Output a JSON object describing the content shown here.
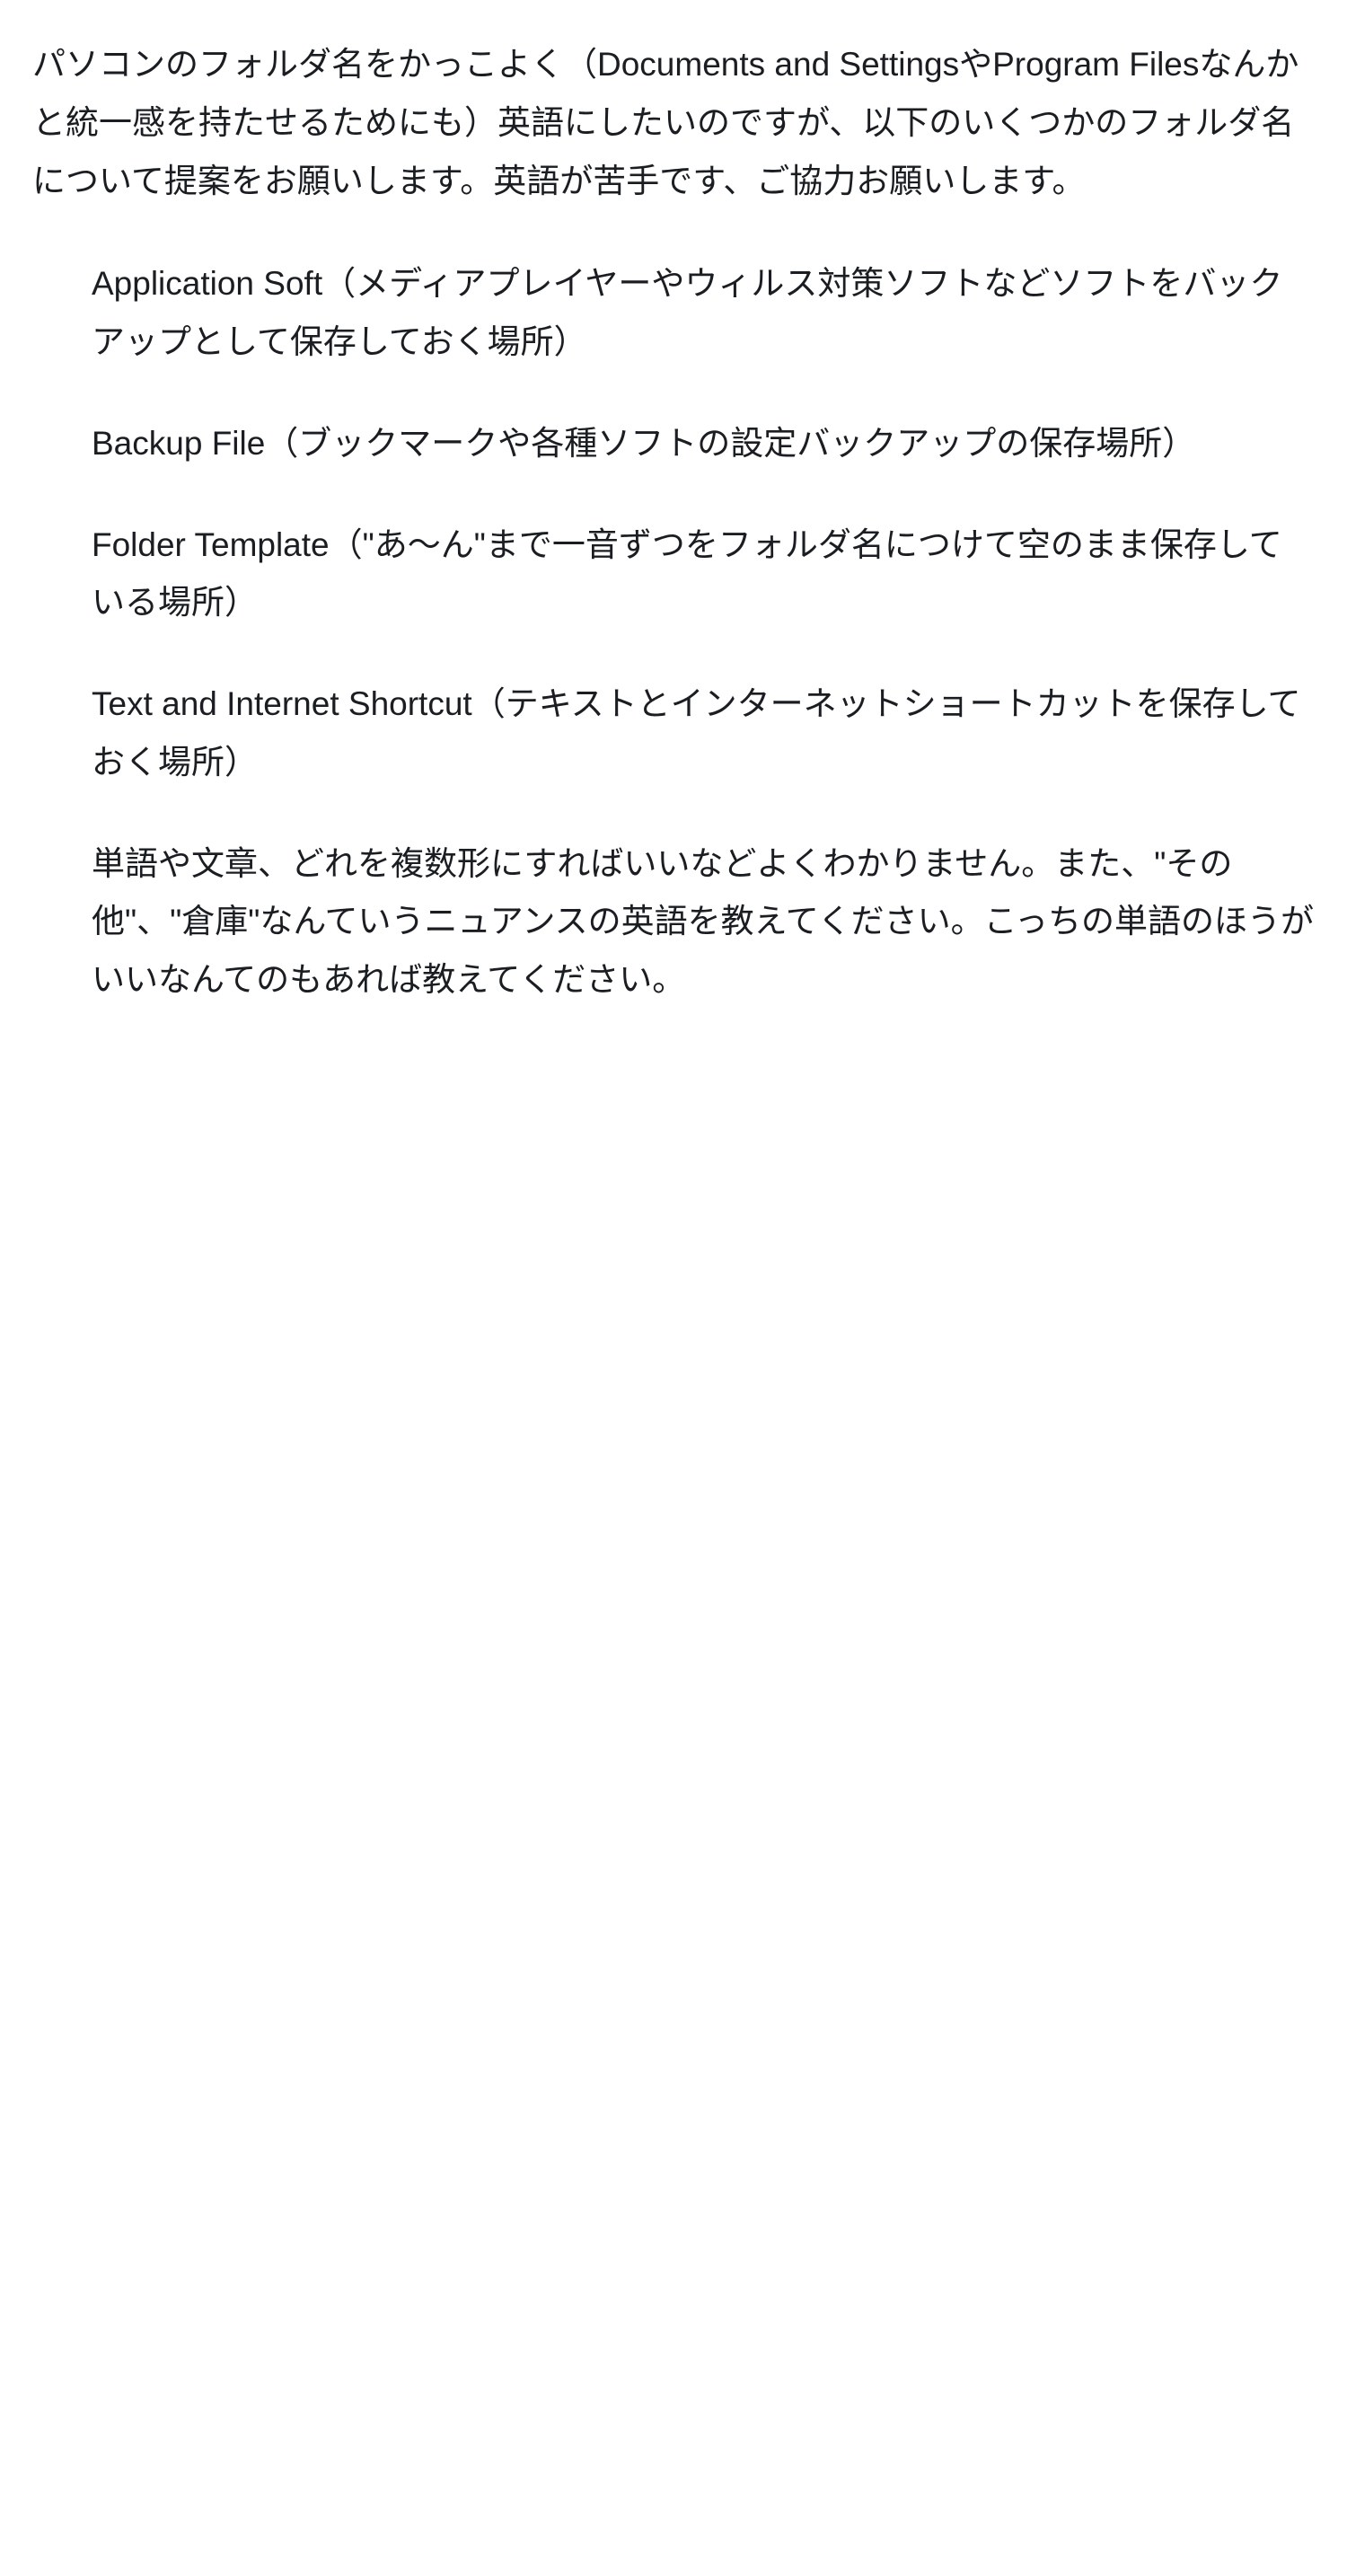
{
  "intro": "パソコンのフォルダ名をかっこよく（Documents and SettingsやProgram Filesなんかと統一感を持たせるためにも）英語にしたいのですが、以下のいくつかのフォルダ名について提案をお願いします。英語が苦手です、ご協力お願いします。",
  "items": [
    "Application Soft（メディアプレイヤーやウィルス対策ソフトなどソフトをバックアップとして保存しておく場所）",
    "Backup File（ブックマークや各種ソフトの設定バックアップの保存場所）",
    "Folder Template（\"あ～ん\"まで一音ずつをフォルダ名につけて空のまま保存している場所）",
    "Text and Internet Shortcut（テキストとインターネットショートカットを保存しておく場所）"
  ],
  "closing": "単語や文章、どれを複数形にすればいいなどよくわかりません。また、\"その他\"、\"倉庫\"なんていうニュアンスの英語を教えてください。こっちの単語のほうがいいなんてのもあれば教えてください。"
}
